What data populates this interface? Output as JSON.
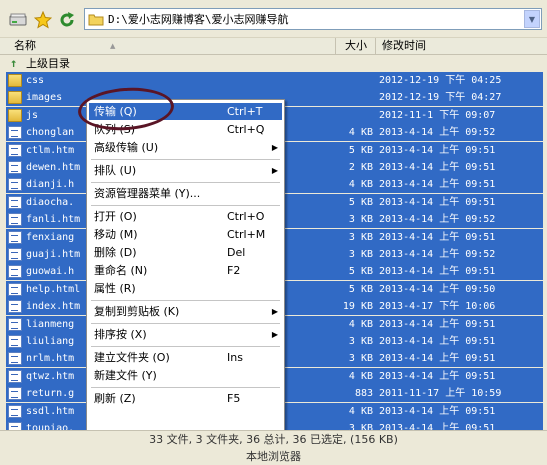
{
  "toolbar": {
    "path": "D:\\爱小志网赚博客\\爱小志网赚导航"
  },
  "columns": {
    "name": "名称",
    "size": "大小",
    "modified": "修改时间"
  },
  "parent_dir": "上级目录",
  "files": [
    {
      "name": "css",
      "size": "",
      "date": "2012-12-19 下午 04:25",
      "kind": "folder"
    },
    {
      "name": "images",
      "size": "",
      "date": "2012-12-19 下午 04:27",
      "kind": "folder"
    },
    {
      "name": "js",
      "size": "",
      "date": "2012-11-1  下午 09:07",
      "kind": "folder"
    },
    {
      "name": "chonglan",
      "size": "4 KB",
      "date": "2013-4-14 上午 09:52",
      "kind": "file"
    },
    {
      "name": "ctlm.htm",
      "size": "5 KB",
      "date": "2013-4-14 上午 09:51",
      "kind": "file"
    },
    {
      "name": "dewen.htm",
      "size": "2 KB",
      "date": "2013-4-14 上午 09:51",
      "kind": "file"
    },
    {
      "name": "dianji.h",
      "size": "4 KB",
      "date": "2013-4-14 上午 09:51",
      "kind": "file"
    },
    {
      "name": "diaocha.",
      "size": "5 KB",
      "date": "2013-4-14 上午 09:51",
      "kind": "file"
    },
    {
      "name": "fanli.htm",
      "size": "3 KB",
      "date": "2013-4-14 上午 09:52",
      "kind": "file"
    },
    {
      "name": "fenxiang",
      "size": "3 KB",
      "date": "2013-4-14 上午 09:51",
      "kind": "file"
    },
    {
      "name": "guaji.htm",
      "size": "3 KB",
      "date": "2013-4-14 上午 09:52",
      "kind": "file"
    },
    {
      "name": "guowai.h",
      "size": "5 KB",
      "date": "2013-4-14 上午 09:51",
      "kind": "file"
    },
    {
      "name": "help.html",
      "size": "5 KB",
      "date": "2013-4-14 上午 09:50",
      "kind": "file"
    },
    {
      "name": "index.htm",
      "size": "19 KB",
      "date": "2013-4-17 下午 10:06",
      "kind": "file"
    },
    {
      "name": "lianmeng",
      "size": "4 KB",
      "date": "2013-4-14 上午 09:51",
      "kind": "file"
    },
    {
      "name": "liuliang",
      "size": "3 KB",
      "date": "2013-4-14 上午 09:51",
      "kind": "file"
    },
    {
      "name": "nrlm.htm",
      "size": "3 KB",
      "date": "2013-4-14 上午 09:51",
      "kind": "file"
    },
    {
      "name": "qtwz.htm",
      "size": "4 KB",
      "date": "2013-4-14 上午 09:51",
      "kind": "file"
    },
    {
      "name": "return.g",
      "size": "883",
      "date": "2011-11-17 上午 10:59",
      "kind": "file"
    },
    {
      "name": "ssdl.htm",
      "size": "4 KB",
      "date": "2013-4-14 上午 09:51",
      "kind": "file"
    },
    {
      "name": "toupiao.",
      "size": "3 KB",
      "date": "2013-4-14 上午 09:51",
      "kind": "file"
    }
  ],
  "context_menu": [
    {
      "label": "传输  (Q)",
      "shortcut": "Ctrl+T",
      "arrow": false,
      "highlighted": true
    },
    {
      "label": "队列  (S)",
      "shortcut": "Ctrl+Q",
      "arrow": false
    },
    {
      "label": "高级传输  (U)",
      "shortcut": "",
      "arrow": true
    },
    {
      "sep": true
    },
    {
      "label": "排队  (U)",
      "shortcut": "",
      "arrow": true
    },
    {
      "sep": true
    },
    {
      "label": "资源管理器菜单  (Y)...",
      "shortcut": "",
      "arrow": false
    },
    {
      "sep": true
    },
    {
      "label": "打开 (O)",
      "shortcut": "Ctrl+O",
      "arrow": false
    },
    {
      "label": "移动 (M)",
      "shortcut": "Ctrl+M",
      "arrow": false
    },
    {
      "label": "删除 (D)",
      "shortcut": "Del",
      "arrow": false
    },
    {
      "label": "重命名 (N)",
      "shortcut": "F2",
      "arrow": false
    },
    {
      "label": "属性 (R)",
      "shortcut": "",
      "arrow": false
    },
    {
      "sep": true
    },
    {
      "label": "复制到剪贴板  (K)",
      "shortcut": "",
      "arrow": true
    },
    {
      "sep": true
    },
    {
      "label": "排序按  (X)",
      "shortcut": "",
      "arrow": true
    },
    {
      "sep": true
    },
    {
      "label": "建立文件夹 (O)",
      "shortcut": "Ins",
      "arrow": false
    },
    {
      "label": "新建文件  (Y)",
      "shortcut": "",
      "arrow": false
    },
    {
      "sep": true
    },
    {
      "label": "刷新  (Z)",
      "shortcut": "F5",
      "arrow": false
    }
  ],
  "status": {
    "summary": "33 文件, 3 文件夹, 36 总计, 36 已选定, (156 KB)",
    "location": "本地浏览器"
  },
  "colors": {
    "selection": "#316ac5",
    "annotation_circle": "#5a1526"
  }
}
